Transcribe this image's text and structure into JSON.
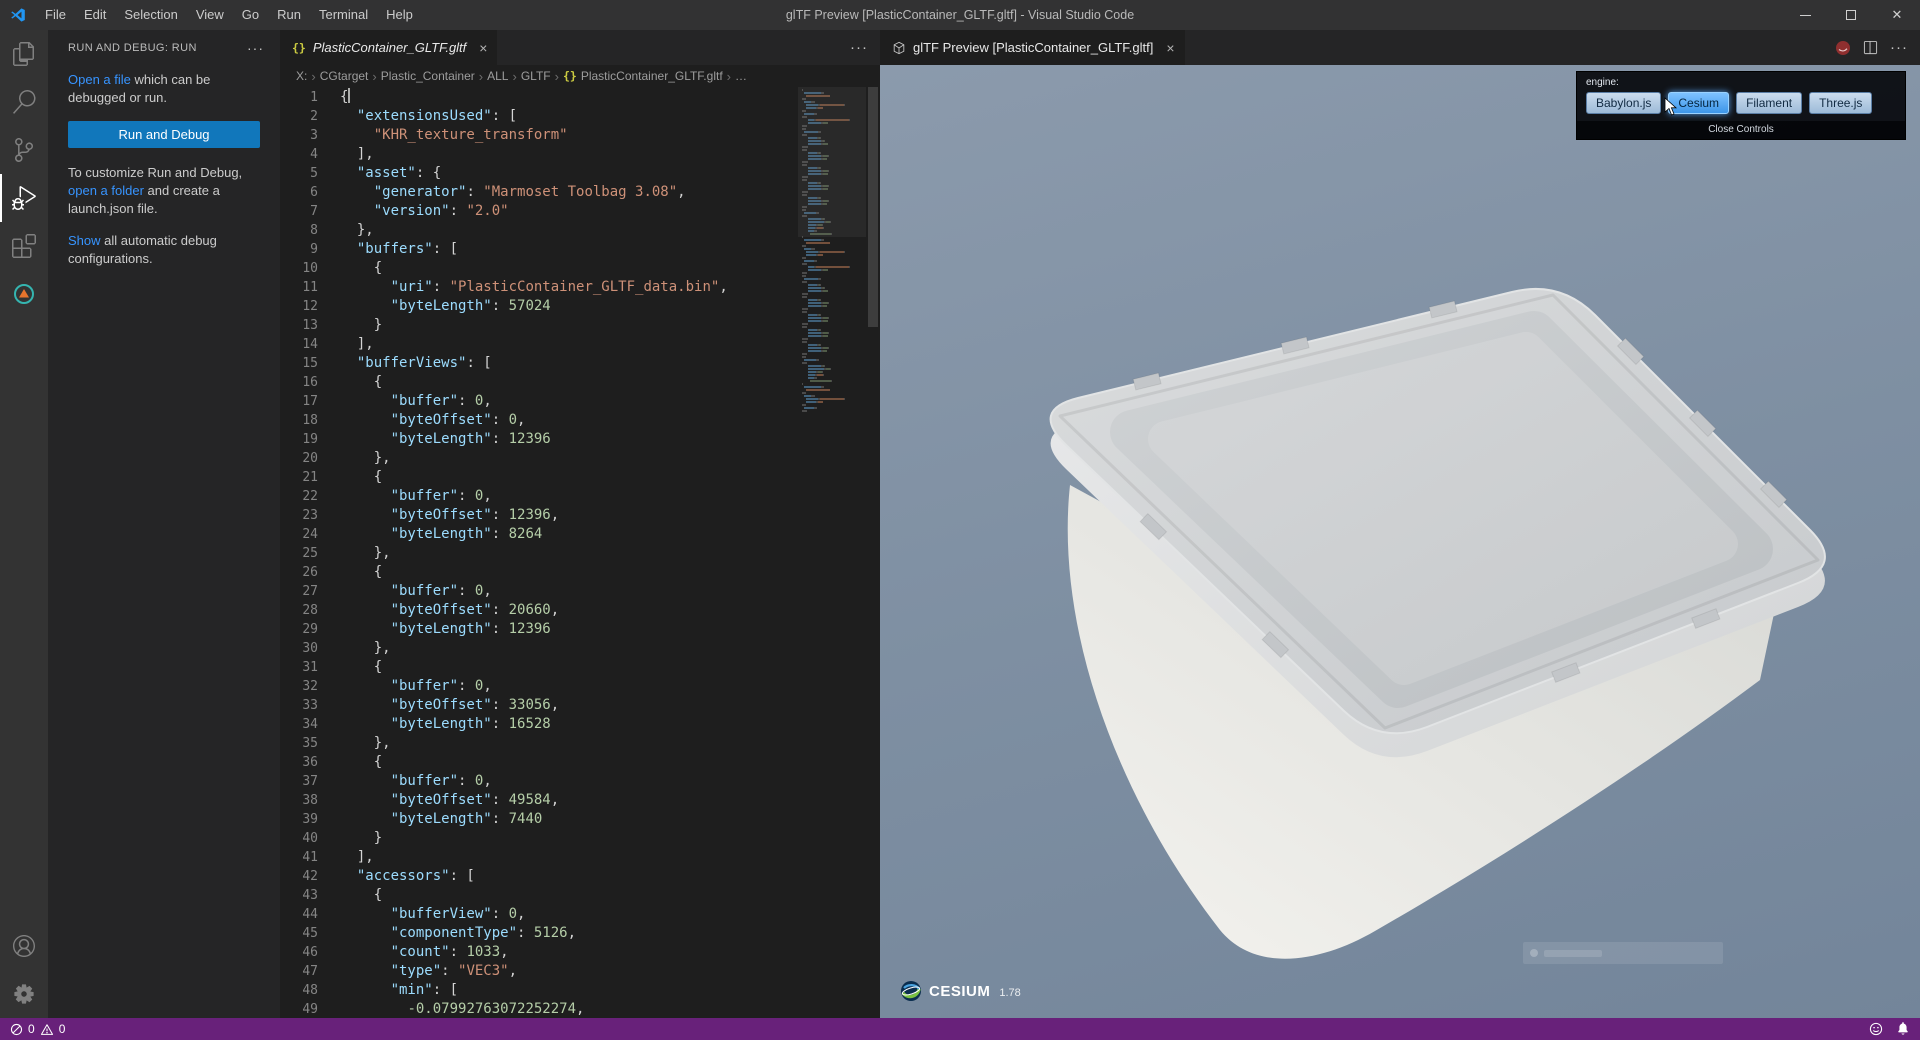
{
  "title_bar": {
    "menus": [
      "File",
      "Edit",
      "Selection",
      "View",
      "Go",
      "Run",
      "Terminal",
      "Help"
    ],
    "title": "glTF Preview [PlasticContainer_GLTF.gltf] - Visual Studio Code"
  },
  "activity_bar": {
    "items": [
      "explorer-icon",
      "search-icon",
      "source-control-icon",
      "run-and-debug-icon",
      "extensions-icon",
      "gltf-tools-icon"
    ],
    "active_item": "run-and-debug-icon",
    "bottom_items": [
      "account-icon",
      "settings-gear-icon"
    ]
  },
  "sidebar": {
    "header": "RUN AND DEBUG: RUN",
    "open_file": {
      "link": "Open a file",
      "rest": " which can be debugged or run."
    },
    "run_button_label": "Run and Debug",
    "customize": {
      "pre": "To customize Run and Debug, ",
      "link": "open a folder",
      "post": " and create a launch.json file."
    },
    "show_all": {
      "link": "Show",
      "rest": " all automatic debug configurations."
    }
  },
  "editor": {
    "tab_label": "PlasticContainer_GLTF.gltf",
    "close_glyph": "×",
    "breadcrumb": [
      {
        "label": "X:"
      },
      {
        "label": "CGtarget"
      },
      {
        "label": "Plastic_Container"
      },
      {
        "label": "ALL"
      },
      {
        "label": "GLTF"
      },
      {
        "label": "PlasticContainer_GLTF.gltf",
        "icon": "json"
      },
      {
        "label": "…"
      }
    ],
    "lines": [
      [
        [
          "p",
          "{"
        ]
      ],
      [
        [
          "p",
          "  "
        ],
        [
          "k",
          "\"extensionsUsed\""
        ],
        [
          "p",
          ": ["
        ]
      ],
      [
        [
          "p",
          "    "
        ],
        [
          "s",
          "\"KHR_texture_transform\""
        ]
      ],
      [
        [
          "p",
          "  ],"
        ]
      ],
      [
        [
          "p",
          "  "
        ],
        [
          "k",
          "\"asset\""
        ],
        [
          "p",
          ": {"
        ]
      ],
      [
        [
          "p",
          "    "
        ],
        [
          "k",
          "\"generator\""
        ],
        [
          "p",
          ": "
        ],
        [
          "s",
          "\"Marmoset Toolbag 3.08\""
        ],
        [
          "p",
          ","
        ]
      ],
      [
        [
          "p",
          "    "
        ],
        [
          "k",
          "\"version\""
        ],
        [
          "p",
          ": "
        ],
        [
          "s",
          "\"2.0\""
        ]
      ],
      [
        [
          "p",
          "  },"
        ]
      ],
      [
        [
          "p",
          "  "
        ],
        [
          "k",
          "\"buffers\""
        ],
        [
          "p",
          ": ["
        ]
      ],
      [
        [
          "p",
          "    {"
        ]
      ],
      [
        [
          "p",
          "      "
        ],
        [
          "k",
          "\"uri\""
        ],
        [
          "p",
          ": "
        ],
        [
          "s",
          "\"PlasticContainer_GLTF_data.bin\""
        ],
        [
          "p",
          ","
        ]
      ],
      [
        [
          "p",
          "      "
        ],
        [
          "k",
          "\"byteLength\""
        ],
        [
          "p",
          ": "
        ],
        [
          "n",
          "57024"
        ]
      ],
      [
        [
          "p",
          "    }"
        ]
      ],
      [
        [
          "p",
          "  ],"
        ]
      ],
      [
        [
          "p",
          "  "
        ],
        [
          "k",
          "\"bufferViews\""
        ],
        [
          "p",
          ": ["
        ]
      ],
      [
        [
          "p",
          "    {"
        ]
      ],
      [
        [
          "p",
          "      "
        ],
        [
          "k",
          "\"buffer\""
        ],
        [
          "p",
          ": "
        ],
        [
          "n",
          "0"
        ],
        [
          "p",
          ","
        ]
      ],
      [
        [
          "p",
          "      "
        ],
        [
          "k",
          "\"byteOffset\""
        ],
        [
          "p",
          ": "
        ],
        [
          "n",
          "0"
        ],
        [
          "p",
          ","
        ]
      ],
      [
        [
          "p",
          "      "
        ],
        [
          "k",
          "\"byteLength\""
        ],
        [
          "p",
          ": "
        ],
        [
          "n",
          "12396"
        ]
      ],
      [
        [
          "p",
          "    },"
        ]
      ],
      [
        [
          "p",
          "    {"
        ]
      ],
      [
        [
          "p",
          "      "
        ],
        [
          "k",
          "\"buffer\""
        ],
        [
          "p",
          ": "
        ],
        [
          "n",
          "0"
        ],
        [
          "p",
          ","
        ]
      ],
      [
        [
          "p",
          "      "
        ],
        [
          "k",
          "\"byteOffset\""
        ],
        [
          "p",
          ": "
        ],
        [
          "n",
          "12396"
        ],
        [
          "p",
          ","
        ]
      ],
      [
        [
          "p",
          "      "
        ],
        [
          "k",
          "\"byteLength\""
        ],
        [
          "p",
          ": "
        ],
        [
          "n",
          "8264"
        ]
      ],
      [
        [
          "p",
          "    },"
        ]
      ],
      [
        [
          "p",
          "    {"
        ]
      ],
      [
        [
          "p",
          "      "
        ],
        [
          "k",
          "\"buffer\""
        ],
        [
          "p",
          ": "
        ],
        [
          "n",
          "0"
        ],
        [
          "p",
          ","
        ]
      ],
      [
        [
          "p",
          "      "
        ],
        [
          "k",
          "\"byteOffset\""
        ],
        [
          "p",
          ": "
        ],
        [
          "n",
          "20660"
        ],
        [
          "p",
          ","
        ]
      ],
      [
        [
          "p",
          "      "
        ],
        [
          "k",
          "\"byteLength\""
        ],
        [
          "p",
          ": "
        ],
        [
          "n",
          "12396"
        ]
      ],
      [
        [
          "p",
          "    },"
        ]
      ],
      [
        [
          "p",
          "    {"
        ]
      ],
      [
        [
          "p",
          "      "
        ],
        [
          "k",
          "\"buffer\""
        ],
        [
          "p",
          ": "
        ],
        [
          "n",
          "0"
        ],
        [
          "p",
          ","
        ]
      ],
      [
        [
          "p",
          "      "
        ],
        [
          "k",
          "\"byteOffset\""
        ],
        [
          "p",
          ": "
        ],
        [
          "n",
          "33056"
        ],
        [
          "p",
          ","
        ]
      ],
      [
        [
          "p",
          "      "
        ],
        [
          "k",
          "\"byteLength\""
        ],
        [
          "p",
          ": "
        ],
        [
          "n",
          "16528"
        ]
      ],
      [
        [
          "p",
          "    },"
        ]
      ],
      [
        [
          "p",
          "    {"
        ]
      ],
      [
        [
          "p",
          "      "
        ],
        [
          "k",
          "\"buffer\""
        ],
        [
          "p",
          ": "
        ],
        [
          "n",
          "0"
        ],
        [
          "p",
          ","
        ]
      ],
      [
        [
          "p",
          "      "
        ],
        [
          "k",
          "\"byteOffset\""
        ],
        [
          "p",
          ": "
        ],
        [
          "n",
          "49584"
        ],
        [
          "p",
          ","
        ]
      ],
      [
        [
          "p",
          "      "
        ],
        [
          "k",
          "\"byteLength\""
        ],
        [
          "p",
          ": "
        ],
        [
          "n",
          "7440"
        ]
      ],
      [
        [
          "p",
          "    }"
        ]
      ],
      [
        [
          "p",
          "  ],"
        ]
      ],
      [
        [
          "p",
          "  "
        ],
        [
          "k",
          "\"accessors\""
        ],
        [
          "p",
          ": ["
        ]
      ],
      [
        [
          "p",
          "    {"
        ]
      ],
      [
        [
          "p",
          "      "
        ],
        [
          "k",
          "\"bufferView\""
        ],
        [
          "p",
          ": "
        ],
        [
          "n",
          "0"
        ],
        [
          "p",
          ","
        ]
      ],
      [
        [
          "p",
          "      "
        ],
        [
          "k",
          "\"componentType\""
        ],
        [
          "p",
          ": "
        ],
        [
          "n",
          "5126"
        ],
        [
          "p",
          ","
        ]
      ],
      [
        [
          "p",
          "      "
        ],
        [
          "k",
          "\"count\""
        ],
        [
          "p",
          ": "
        ],
        [
          "n",
          "1033"
        ],
        [
          "p",
          ","
        ]
      ],
      [
        [
          "p",
          "      "
        ],
        [
          "k",
          "\"type\""
        ],
        [
          "p",
          ": "
        ],
        [
          "s",
          "\"VEC3\""
        ],
        [
          "p",
          ","
        ]
      ],
      [
        [
          "p",
          "      "
        ],
        [
          "k",
          "\"min\""
        ],
        [
          "p",
          ": ["
        ]
      ],
      [
        [
          "p",
          "        "
        ],
        [
          "n",
          "-0.07992763072252274"
        ],
        [
          "p",
          ","
        ]
      ]
    ]
  },
  "preview": {
    "tab_label": "glTF Preview [PlasticContainer_GLTF.gltf]",
    "close_glyph": "×",
    "engine_label": "engine:",
    "engines": [
      "Babylon.js",
      "Cesium",
      "Filament",
      "Three.js"
    ],
    "active_engine": "Cesium",
    "close_controls_label": "Close Controls",
    "cesium_brand": "CESIUM",
    "cesium_version": "1.78"
  },
  "status_bar": {
    "errors": "0",
    "warnings": "0",
    "icons": [
      "errors-icon",
      "warnings-icon",
      "feedback-smiley-icon",
      "bell-icon"
    ]
  },
  "colors": {
    "run_button": "#1177bb",
    "status_bar": "#68217a",
    "link": "#3794ff",
    "viewport_top": "#8b9aac",
    "viewport_bottom": "#73859a"
  }
}
